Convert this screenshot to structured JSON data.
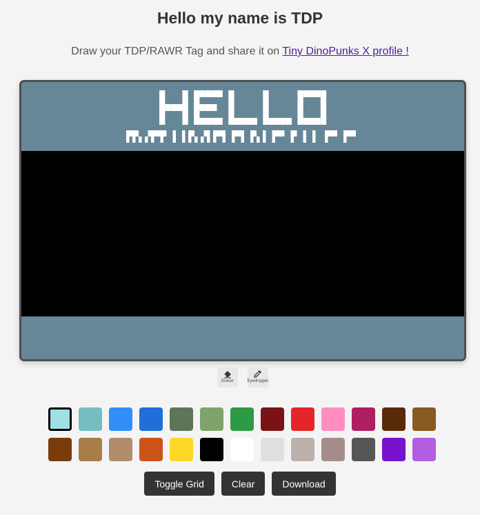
{
  "header": {
    "title": "Hello my name is TDP",
    "subtitle_prefix": "Draw your TDP/RAWR Tag and share it on ",
    "link_text": "Tiny DinoPunks X profile !"
  },
  "tag": {
    "bg_color": "#668797",
    "draw_color": "#000000",
    "header_word": "HELLO"
  },
  "tools": [
    {
      "name": "eraser",
      "label": "Eraser",
      "icon": "eraser-icon"
    },
    {
      "name": "eyedropper",
      "label": "Eyedropper",
      "icon": "eyedropper-icon"
    }
  ],
  "palette": {
    "selected_index": 0,
    "colors": [
      "#9ee0e4",
      "#75bdbf",
      "#318ef7",
      "#1e6fd6",
      "#5f7558",
      "#7ea46c",
      "#2d9a46",
      "#791316",
      "#e3262c",
      "#ff8dc0",
      "#ad1f60",
      "#592a07",
      "#8a5a23",
      "#7b3b0b",
      "#a97d48",
      "#b18d6b",
      "#cd5419",
      "#ffd827",
      "#000000",
      "#ffffff",
      "#dfdfdf",
      "#bbb0aa",
      "#a68d8b",
      "#565656",
      "#7712cc",
      "#b35de2"
    ]
  },
  "buttons": {
    "toggle_grid": "Toggle Grid",
    "clear": "Clear",
    "download": "Download"
  }
}
